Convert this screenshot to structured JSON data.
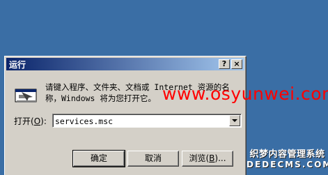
{
  "dialog": {
    "title": "运行",
    "help_button": "?",
    "close_button": "×",
    "description_line1": "请键入程序、文件夹、文档或 Internet 资源的名",
    "description_line2": "称，Windows 将为您打开它。",
    "open_label": "打开",
    "open_accel": "O",
    "open_value": "services.msc",
    "ok_label": "确定",
    "cancel_label": "取消",
    "browse_label": "浏览",
    "browse_accel": "B"
  },
  "watermark": {
    "text": "www.osyunwei.com"
  },
  "logo": {
    "line1": "织梦内容管理系统",
    "line2": "DEDECMS.COM"
  },
  "colors": {
    "desktop": "#3a6ea5",
    "title_bar": "#0a246a",
    "dialog_face": "#d4d0c8",
    "watermark": "#ff0000"
  }
}
